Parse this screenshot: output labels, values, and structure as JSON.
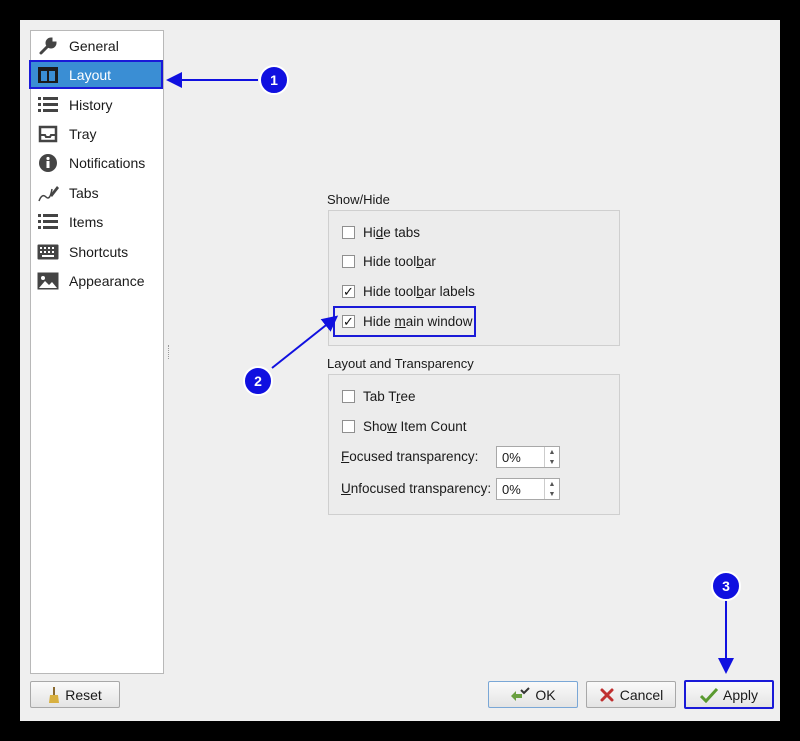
{
  "sidebar": {
    "items": [
      {
        "label": "General",
        "icon": "wrench-icon"
      },
      {
        "label": "Layout",
        "icon": "layout-icon",
        "selected": true
      },
      {
        "label": "History",
        "icon": "list-icon"
      },
      {
        "label": "Tray",
        "icon": "tray-icon"
      },
      {
        "label": "Notifications",
        "icon": "info-icon"
      },
      {
        "label": "Tabs",
        "icon": "pen-icon"
      },
      {
        "label": "Items",
        "icon": "list-icon"
      },
      {
        "label": "Shortcuts",
        "icon": "keyboard-icon"
      },
      {
        "label": "Appearance",
        "icon": "image-icon"
      }
    ]
  },
  "show_hide": {
    "title": "Show/Hide",
    "options": [
      {
        "pre": "Hi",
        "u": "d",
        "post": "e tabs",
        "checked": false
      },
      {
        "pre": "Hide tool",
        "u": "b",
        "post": "ar",
        "checked": false
      },
      {
        "pre": "Hide tool",
        "u": "b",
        "post": "ar labels",
        "checked": true
      },
      {
        "pre": "Hide ",
        "u": "m",
        "post": "ain window",
        "checked": true
      }
    ]
  },
  "layout_transparency": {
    "title": "Layout and Transparency",
    "tab_tree": {
      "pre": "Tab T",
      "u": "r",
      "post": "ee",
      "checked": false
    },
    "show_item_count": {
      "pre": "Sho",
      "u": "w",
      "post": " Item Count",
      "checked": false
    },
    "focused": {
      "u": "F",
      "post": "ocused transparency:",
      "value": "0%"
    },
    "unfocused": {
      "u": "U",
      "post": "nfocused transparency:",
      "value": "0%"
    }
  },
  "buttons": {
    "reset": "Reset",
    "ok": "OK",
    "cancel": "Cancel",
    "apply": "Apply"
  },
  "annotations": {
    "badge_1": "1",
    "badge_2": "2",
    "badge_3": "3"
  },
  "colors": {
    "annotation": "#1010e0",
    "selection": "#3a8ed4"
  }
}
